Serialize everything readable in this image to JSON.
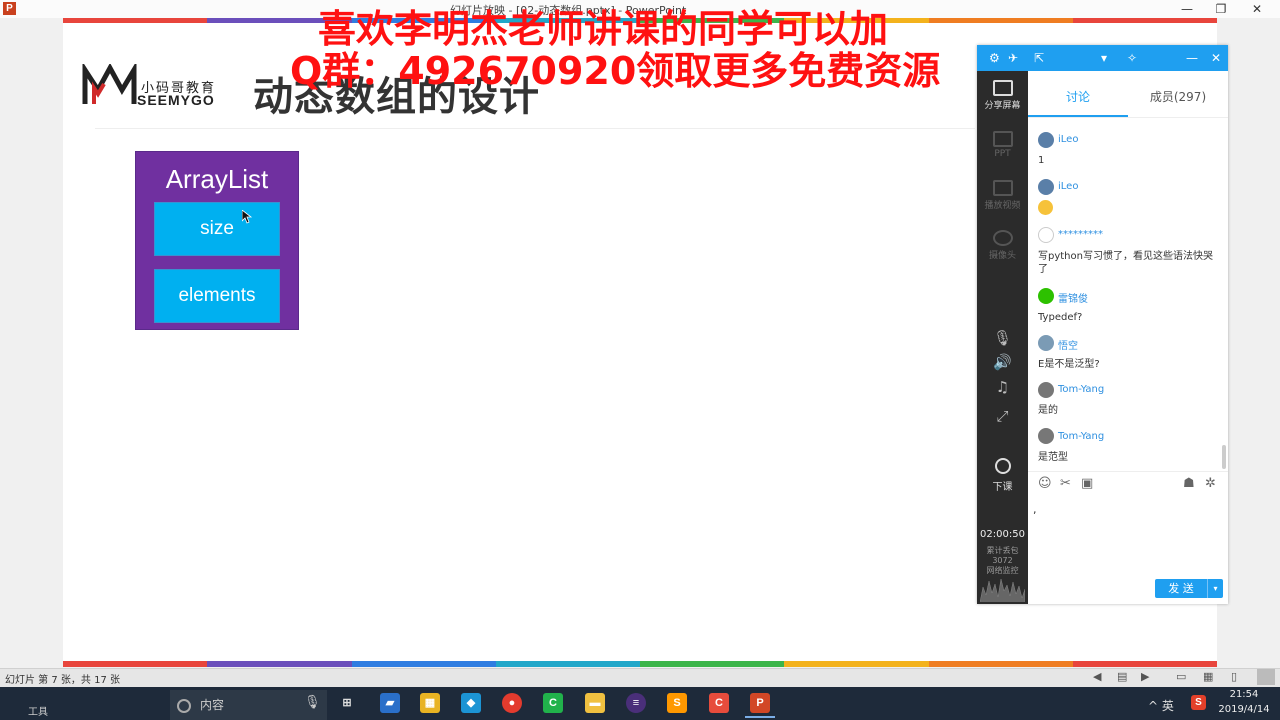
{
  "window": {
    "title": "幻灯片放映 - [02-动态数组.pptx] - PowerPoint",
    "minimize": "—",
    "restore": "❐",
    "close": "✕"
  },
  "slide": {
    "title": "动态数组的设计",
    "logo_name": "小码哥教育",
    "logo_en": "SEEMYGO",
    "stripe_colors": [
      "#e8453c",
      "#6b4fbb",
      "#2f7de1",
      "#22a7c9",
      "#3cb54a",
      "#f3b21c",
      "#ef7d22",
      "#e8453c"
    ]
  },
  "diagram": {
    "class_name": "ArrayList",
    "fields": [
      "size",
      "elements"
    ]
  },
  "watermark": {
    "line1": "喜欢李明杰老师讲课的同学可以加",
    "line2": "Q群：492670920领取更多免费资源"
  },
  "panel": {
    "side_items": {
      "share": "分享屏幕",
      "ppt": "PPT",
      "video": "播放视频",
      "camera": "摄像头",
      "end_class": "下课"
    },
    "timer": "02:00:50",
    "stats_line1": "累计丢包",
    "stats_line2": "3072",
    "stats_line3": "网络监控",
    "tabs": {
      "discuss": "讨论",
      "members": "成员(297)"
    },
    "messages": [
      {
        "name": "iLeo",
        "text": "1"
      },
      {
        "name": "iLeo",
        "text": ""
      },
      {
        "name": "*********",
        "text": "写python写习惯了，看见这些语法快哭了"
      },
      {
        "name": "雷锦俊",
        "text": "Typedef?"
      },
      {
        "name": "悟空",
        "text": "E是不是泛型?"
      },
      {
        "name": "Tom-Yang",
        "text": "是的"
      },
      {
        "name": "Tom-Yang",
        "text": "是范型"
      }
    ],
    "input_value": ",",
    "send_label": "发 送"
  },
  "statusbar": {
    "text": "幻灯片 第 7 张，共 17 张"
  },
  "taskbar": {
    "tools_label": "工具",
    "search_text": "内容",
    "tray_lang": "英",
    "time": "21:54",
    "date": "2019/4/14"
  }
}
